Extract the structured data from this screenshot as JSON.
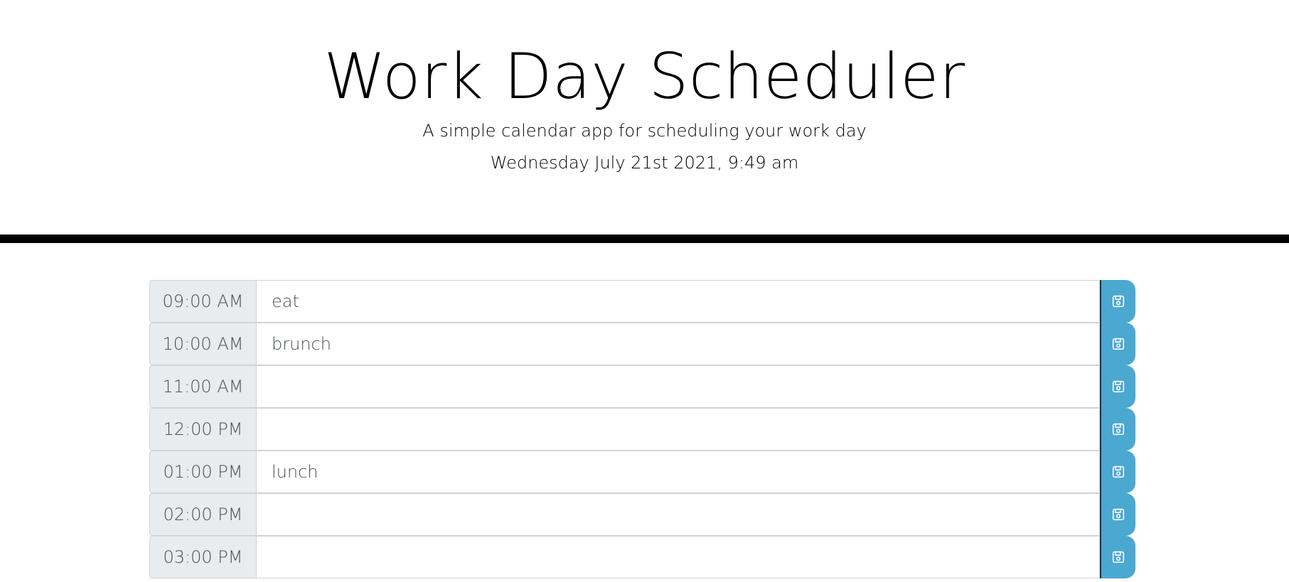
{
  "header": {
    "title": "Work Day Scheduler",
    "subtitle": "A simple calendar app for scheduling your work day",
    "current_day": "Wednesday July 21st 2021, 9:49 am"
  },
  "colors": {
    "save_button": "#4aa8d1",
    "hour_background": "#e9ecef",
    "divider": "#000000"
  },
  "timeblocks": [
    {
      "hour": "09:00 AM",
      "description": "eat"
    },
    {
      "hour": "10:00 AM",
      "description": "brunch"
    },
    {
      "hour": "11:00 AM",
      "description": ""
    },
    {
      "hour": "12:00 PM",
      "description": ""
    },
    {
      "hour": "01:00 PM",
      "description": "lunch"
    },
    {
      "hour": "02:00 PM",
      "description": ""
    },
    {
      "hour": "03:00 PM",
      "description": ""
    }
  ],
  "icons": {
    "save": "floppy-disk-icon"
  }
}
